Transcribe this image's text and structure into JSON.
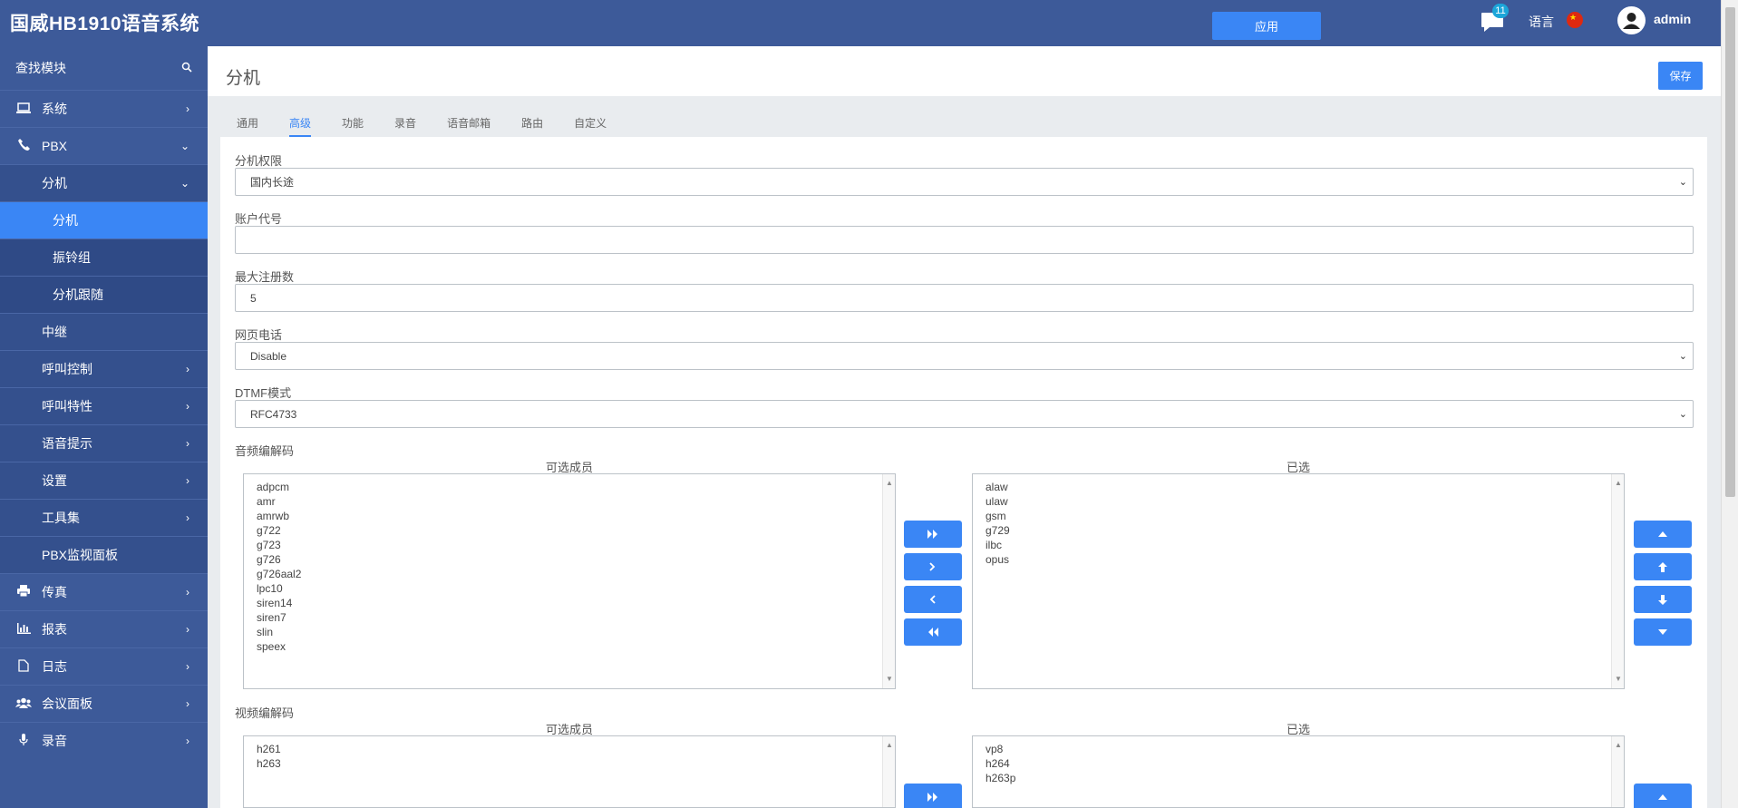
{
  "app": {
    "brand": "国威HB1910语音系统",
    "apply_label": "应用",
    "message_count": "11",
    "language_label": "语言",
    "username": "admin"
  },
  "sidebar": {
    "search_label": "查找模块",
    "items": [
      {
        "label": "系统",
        "icon": "laptop-icon",
        "arrow": "›"
      },
      {
        "label": "PBX",
        "icon": "phone-icon",
        "arrow": "⌄"
      },
      {
        "label": "分机",
        "arrow": "⌄"
      },
      {
        "label": "分机"
      },
      {
        "label": "振铃组"
      },
      {
        "label": "分机跟随"
      },
      {
        "label": "中继"
      },
      {
        "label": "呼叫控制",
        "arrow": "›"
      },
      {
        "label": "呼叫特性",
        "arrow": "›"
      },
      {
        "label": "语音提示",
        "arrow": "›"
      },
      {
        "label": "设置",
        "arrow": "›"
      },
      {
        "label": "工具集",
        "arrow": "›"
      },
      {
        "label": "PBX监视面板"
      },
      {
        "label": "传真",
        "icon": "printer-icon",
        "arrow": "›"
      },
      {
        "label": "报表",
        "icon": "bar-chart-icon",
        "arrow": "›"
      },
      {
        "label": "日志",
        "icon": "file-icon",
        "arrow": "›"
      },
      {
        "label": "会议面板",
        "icon": "users-icon",
        "arrow": "›"
      },
      {
        "label": "录音",
        "icon": "microphone-icon",
        "arrow": "›"
      }
    ]
  },
  "page": {
    "title": "分机",
    "save_label": "保存",
    "tabs": [
      "通用",
      "高级",
      "功能",
      "录音",
      "语音邮箱",
      "路由",
      "自定义"
    ]
  },
  "form": {
    "ext_permission": {
      "label": "分机权限",
      "value": "国内长途"
    },
    "account_code": {
      "label": "账户代号",
      "value": ""
    },
    "max_reg": {
      "label": "最大注册数",
      "value": "5"
    },
    "web_phone": {
      "label": "网页电话",
      "value": "Disable"
    },
    "dtmf_mode": {
      "label": "DTMF模式",
      "value": "RFC4733"
    }
  },
  "audio_codecs": {
    "label": "音频编解码",
    "available_label": "可选成员",
    "selected_label": "已选",
    "available": [
      "adpcm",
      "amr",
      "amrwb",
      "g722",
      "g723",
      "g726",
      "g726aal2",
      "lpc10",
      "siren14",
      "siren7",
      "slin",
      "speex"
    ],
    "selected": [
      "alaw",
      "ulaw",
      "gsm",
      "g729",
      "ilbc",
      "opus"
    ]
  },
  "video_codecs": {
    "label": "视频编解码",
    "available_label": "可选成员",
    "selected_label": "已选",
    "available": [
      "h261",
      "h263"
    ],
    "selected": [
      "vp8",
      "h264",
      "h263p"
    ]
  },
  "colors": {
    "header": "#3d5a99",
    "accent": "#3a86f5"
  }
}
